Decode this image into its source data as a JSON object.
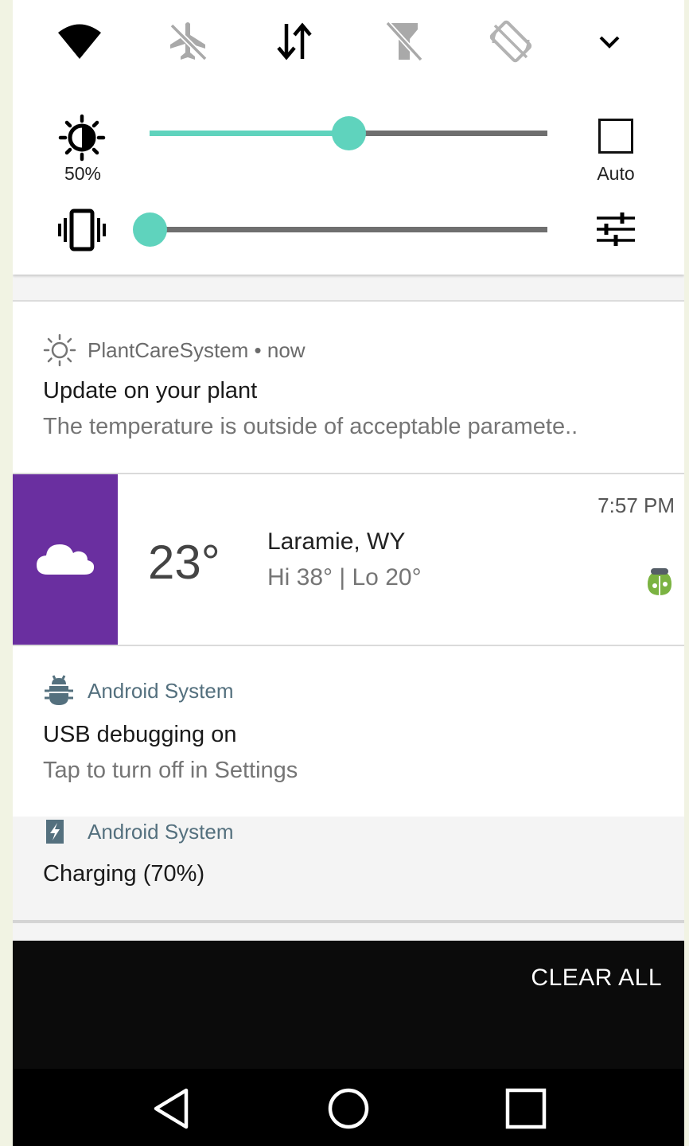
{
  "quick_settings": {
    "tiles": [
      {
        "id": "wifi",
        "icon": "wifi-icon",
        "state": "on"
      },
      {
        "id": "airplane",
        "icon": "airplane-off-icon",
        "state": "off"
      },
      {
        "id": "data",
        "icon": "data-transfer-icon",
        "state": "on"
      },
      {
        "id": "flashlight",
        "icon": "flashlight-off-icon",
        "state": "off"
      },
      {
        "id": "rotation",
        "icon": "rotation-lock-icon",
        "state": "off"
      }
    ],
    "brightness": {
      "label": "50%",
      "level": 0.5
    },
    "auto": {
      "label": "Auto",
      "checked": false
    },
    "volume": {
      "level": 0
    }
  },
  "notifications": [
    {
      "app": "PlantCareSystem",
      "separator": " • ",
      "time": "now",
      "title": "Update on your plant",
      "text": "The temperature is outside of acceptable paramete.."
    },
    {
      "temp": "23°",
      "city": "Laramie, WY",
      "hilo": "Hi 38° | Lo 20°",
      "time": "7:57 PM"
    },
    {
      "app": "Android System",
      "title": "USB debugging on",
      "text": "Tap to turn off in Settings"
    },
    {
      "app": "Android System",
      "title": "Charging (70%)"
    }
  ],
  "clear_all": "CLEAR ALL",
  "colors": {
    "accent": "#5fd3bd",
    "weather_panel": "#6a2fa0",
    "app_name": "#54707e",
    "nav_bg": "#000000"
  }
}
